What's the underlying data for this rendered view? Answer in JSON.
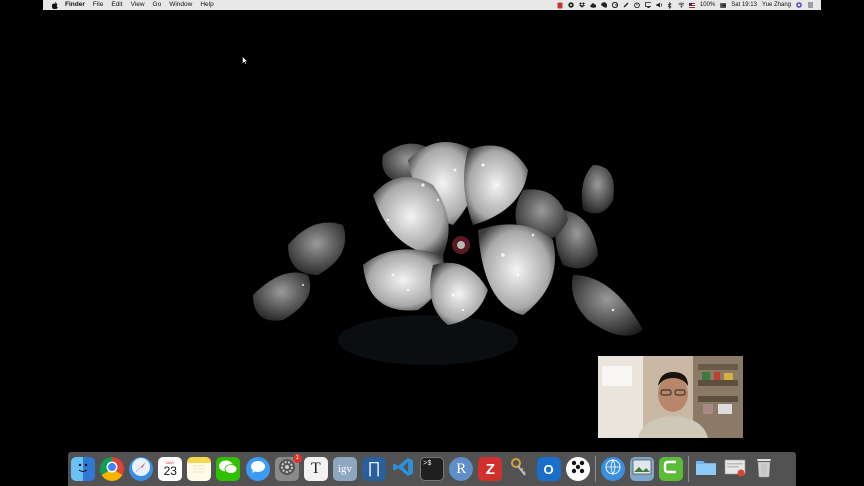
{
  "menubar": {
    "app_name": "Finder",
    "menus": [
      "File",
      "Edit",
      "View",
      "Go",
      "Window",
      "Help"
    ],
    "battery": "100%",
    "clock": "Sat 19:13",
    "user": "Yue Zhang"
  },
  "dock": {
    "items": [
      {
        "name": "Finder",
        "icon": "finder-icon",
        "color": "#3d8fe3"
      },
      {
        "name": "Google Chrome",
        "icon": "chrome-icon",
        "color": "#e8e8e8"
      },
      {
        "name": "Safari",
        "icon": "safari-icon",
        "color": "#3a8ee6"
      },
      {
        "name": "Calendar",
        "icon": "calendar-icon",
        "color": "#ffffff",
        "month": "MAY",
        "day": "23"
      },
      {
        "name": "Notes",
        "icon": "notes-icon",
        "color": "#f6d94a"
      },
      {
        "name": "WeChat",
        "icon": "wechat-icon",
        "color": "#2dc100"
      },
      {
        "name": "Messages",
        "icon": "messages-icon",
        "color": "#3b9bf5"
      },
      {
        "name": "System Preferences",
        "icon": "system-preferences-icon",
        "color": "#8a8a8a",
        "badge": "1"
      },
      {
        "name": "Typora",
        "icon": "typora-icon",
        "color": "#f2f2f2",
        "glyph": "T"
      },
      {
        "name": "IGV",
        "icon": "igv-icon",
        "color": "#8ea6c0",
        "glyph": "igv"
      },
      {
        "name": "PyCharm / IDE",
        "icon": "ide-icon",
        "color": "#2b5f9a",
        "glyph": "∏"
      },
      {
        "name": "Visual Studio Code",
        "icon": "vscode-icon",
        "color": "#2f8fd8"
      },
      {
        "name": "Terminal",
        "icon": "terminal-icon",
        "color": "#1f1f1f",
        "glyph": ">$"
      },
      {
        "name": "R",
        "icon": "r-icon",
        "color": "#5f8ec8",
        "glyph": "R"
      },
      {
        "name": "Zotero",
        "icon": "zotero-icon",
        "color": "#d0312d",
        "glyph": "Z"
      },
      {
        "name": "Keychain Access",
        "icon": "keychain-icon",
        "color": "#9a9a9a"
      },
      {
        "name": "Microsoft Outlook",
        "icon": "outlook-icon",
        "color": "#1a6fc9",
        "glyph": "O"
      },
      {
        "name": "Dots App",
        "icon": "dots-icon",
        "color": "#ffffff"
      },
      {
        "name": "Network Utility",
        "icon": "network-icon",
        "color": "#3b8fe0"
      },
      {
        "name": "Preview",
        "icon": "preview-icon",
        "color": "#7fa7c9"
      },
      {
        "name": "Camtasia",
        "icon": "camtasia-icon",
        "color": "#5dbb3a"
      },
      {
        "name": "Downloads Folder",
        "icon": "folder-icon",
        "color": "#6cb6f0"
      },
      {
        "name": "Recent Document",
        "icon": "document-icon",
        "color": "#e6e6e6"
      },
      {
        "name": "Trash",
        "icon": "trash-icon",
        "color": "#c9c9c9"
      }
    ]
  }
}
